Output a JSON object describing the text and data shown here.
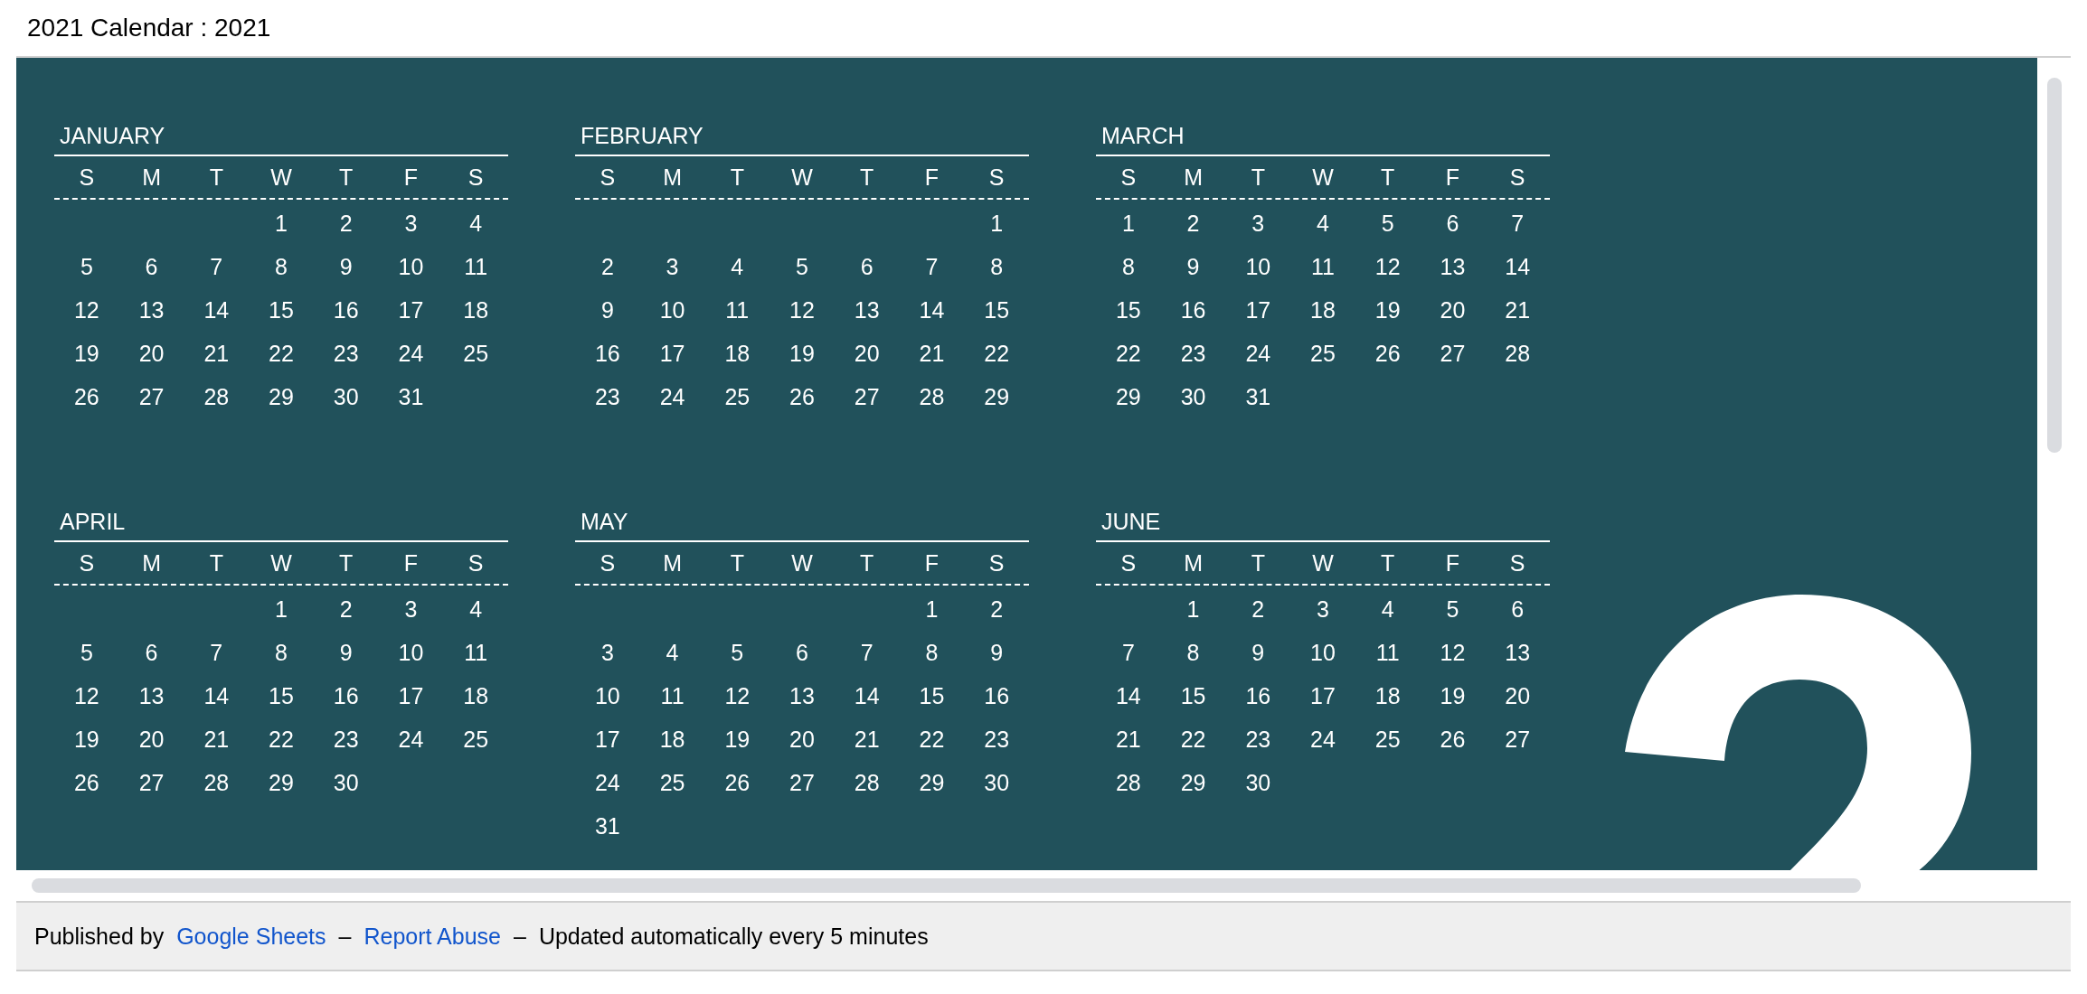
{
  "page_title": "2021 Calendar : 2021",
  "calendar": {
    "months": [
      {
        "name": "JANUARY",
        "weekdays": [
          "S",
          "M",
          "T",
          "W",
          "T",
          "F",
          "S"
        ],
        "weeks": [
          [
            "1",
            "2",
            "3",
            "4"
          ],
          [
            "5",
            "6",
            "7",
            "8",
            "9",
            "10",
            "11"
          ],
          [
            "12",
            "13",
            "14",
            "15",
            "16",
            "17",
            "18"
          ],
          [
            "19",
            "20",
            "21",
            "22",
            "23",
            "24",
            "25"
          ],
          [
            "26",
            "27",
            "28",
            "29",
            "30",
            "31"
          ]
        ]
      },
      {
        "name": "FEBRUARY",
        "weekdays": [
          "S",
          "M",
          "T",
          "W",
          "T",
          "F",
          "S"
        ],
        "weeks": [
          [
            "1"
          ],
          [
            "2",
            "3",
            "4",
            "5",
            "6",
            "7",
            "8"
          ],
          [
            "9",
            "10",
            "11",
            "12",
            "13",
            "14",
            "15"
          ],
          [
            "16",
            "17",
            "18",
            "19",
            "20",
            "21",
            "22"
          ],
          [
            "23",
            "24",
            "25",
            "26",
            "27",
            "28",
            "29"
          ]
        ]
      },
      {
        "name": "MARCH",
        "weekdays": [
          "S",
          "M",
          "T",
          "W",
          "T",
          "F",
          "S"
        ],
        "weeks": [
          [
            "1",
            "2",
            "3",
            "4",
            "5",
            "6",
            "7"
          ],
          [
            "8",
            "9",
            "10",
            "11",
            "12",
            "13",
            "14"
          ],
          [
            "15",
            "16",
            "17",
            "18",
            "19",
            "20",
            "21"
          ],
          [
            "22",
            "23",
            "24",
            "25",
            "26",
            "27",
            "28"
          ],
          [
            "29",
            "30",
            "31"
          ]
        ]
      },
      {
        "name": "APRIL",
        "weekdays": [
          "S",
          "M",
          "T",
          "W",
          "T",
          "F",
          "S"
        ],
        "weeks": [
          [
            "1",
            "2",
            "3",
            "4"
          ],
          [
            "5",
            "6",
            "7",
            "8",
            "9",
            "10",
            "11"
          ],
          [
            "12",
            "13",
            "14",
            "15",
            "16",
            "17",
            "18"
          ],
          [
            "19",
            "20",
            "21",
            "22",
            "23",
            "24",
            "25"
          ],
          [
            "26",
            "27",
            "28",
            "29",
            "30"
          ]
        ]
      },
      {
        "name": "MAY",
        "weekdays": [
          "S",
          "M",
          "T",
          "W",
          "T",
          "F",
          "S"
        ],
        "weeks": [
          [
            "1",
            "2"
          ],
          [
            "3",
            "4",
            "5",
            "6",
            "7",
            "8",
            "9"
          ],
          [
            "10",
            "11",
            "12",
            "13",
            "14",
            "15",
            "16"
          ],
          [
            "17",
            "18",
            "19",
            "20",
            "21",
            "22",
            "23"
          ],
          [
            "24",
            "25",
            "26",
            "27",
            "28",
            "29",
            "30"
          ],
          [
            "31"
          ]
        ]
      },
      {
        "name": "JUNE",
        "weekdays": [
          "S",
          "M",
          "T",
          "W",
          "T",
          "F",
          "S"
        ],
        "weeks": [
          [
            "1",
            "2",
            "3",
            "4",
            "5",
            "6"
          ],
          [
            "7",
            "8",
            "9",
            "10",
            "11",
            "12",
            "13"
          ],
          [
            "14",
            "15",
            "16",
            "17",
            "18",
            "19",
            "20"
          ],
          [
            "21",
            "22",
            "23",
            "24",
            "25",
            "26",
            "27"
          ],
          [
            "28",
            "29",
            "30"
          ]
        ]
      }
    ]
  },
  "footer": {
    "prefix": "Published by",
    "link": "Google Sheets",
    "separator_1": "–",
    "report_link": "Report Abuse",
    "separator_2": "–",
    "note": "Updated automatically every 5 minutes"
  }
}
